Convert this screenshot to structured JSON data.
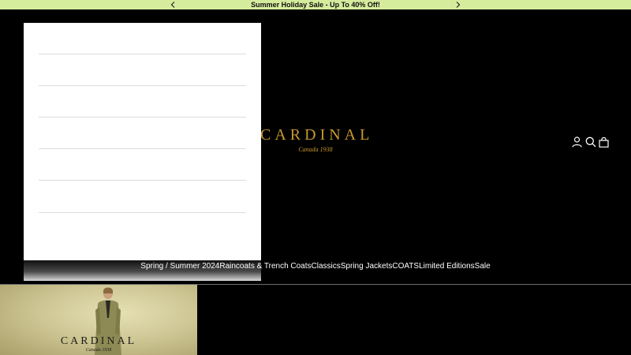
{
  "announcement": {
    "text": "Summer Holiday Sale - Up To 40% Off!",
    "prev_icon": "chevron-left-icon",
    "next_icon": "chevron-right-icon",
    "background": "#d5ec9d"
  },
  "logo": {
    "wordmark": "CARDINAL",
    "tagline": "Canada 1938",
    "color": "#c99a2e"
  },
  "header_icons": [
    "account-icon",
    "search-icon",
    "cart-icon"
  ],
  "nav": {
    "items": [
      "Spring / Summer 2024",
      "Raincoats & Trench Coats",
      "Classics",
      "Spring Jackets",
      "COATS",
      "Limited Editions",
      "Sale"
    ]
  },
  "hero": {
    "wordmark": "CARDINAL",
    "tagline": "Canada 1938"
  },
  "colors": {
    "page_background": "#000000",
    "panel_background": "#ffffff",
    "nav_text": "#ffffff"
  }
}
